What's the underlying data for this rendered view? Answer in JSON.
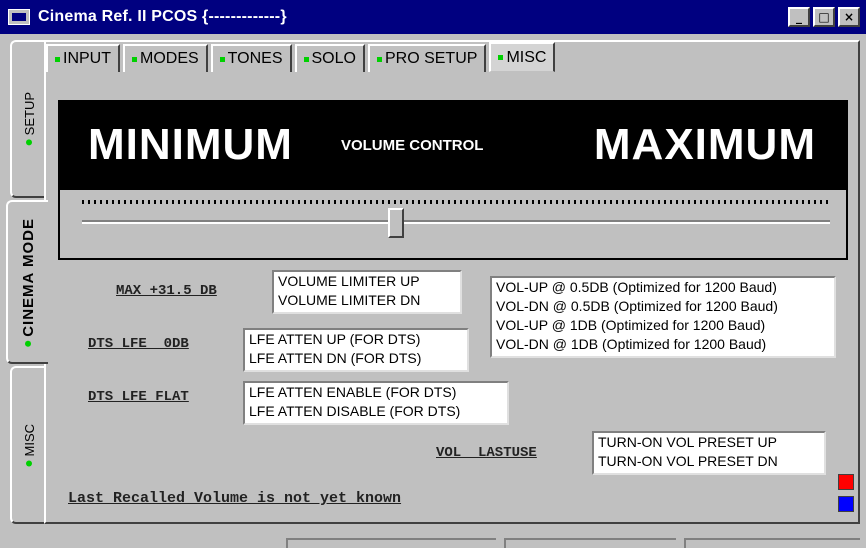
{
  "window": {
    "title": "Cinema Ref. II PCOS {-------------}",
    "controls": {
      "minimize": "_",
      "maximize": "□",
      "close": "×"
    }
  },
  "side_tabs": [
    {
      "label": "SETUP",
      "active": false
    },
    {
      "label": "CINEMA MODE",
      "active": true
    },
    {
      "label": "MISC",
      "active": false
    }
  ],
  "tabs": [
    {
      "label": "INPUT"
    },
    {
      "label": "MODES"
    },
    {
      "label": "TONES"
    },
    {
      "label": "SOLO"
    },
    {
      "label": "PRO SETUP"
    },
    {
      "label": "MISC",
      "active": true
    }
  ],
  "volume": {
    "min_label": "MINIMUM",
    "center_label": "VOLUME CONTROL",
    "max_label": "MAXIMUM",
    "slider_fraction": 0.42
  },
  "max_section": {
    "label": "MAX +31.5 DB",
    "items": [
      "VOLUME LIMITER UP",
      "VOLUME LIMITER DN"
    ]
  },
  "baud_list": {
    "items": [
      "VOL-UP @ 0.5DB (Optimized for 1200 Baud)",
      "VOL-DN @ 0.5DB (Optimized for 1200 Baud)",
      "VOL-UP @ 1DB (Optimized for 1200 Baud)",
      "VOL-DN @ 1DB (Optimized for 1200 Baud)"
    ]
  },
  "dts_lfe_0db": {
    "label": "DTS LFE  0DB",
    "items": [
      "LFE ATTEN UP (FOR DTS)",
      "LFE ATTEN DN (FOR DTS)"
    ]
  },
  "dts_lfe_flat": {
    "label": "DTS LFE FLAT",
    "items": [
      "LFE ATTEN ENABLE (FOR DTS)",
      "LFE ATTEN DISABLE (FOR DTS)"
    ]
  },
  "vol_lastuse": {
    "label": "VOL  LASTUSE",
    "items": [
      "TURN-ON VOL PRESET UP",
      "TURN-ON VOL PRESET DN"
    ]
  },
  "status": {
    "message": "Last Recalled Volume is not yet known"
  },
  "colors": {
    "red_button": "#ff0000",
    "blue_button": "#0000ff",
    "title_bar": "#000080",
    "indicator": "#00d000"
  }
}
